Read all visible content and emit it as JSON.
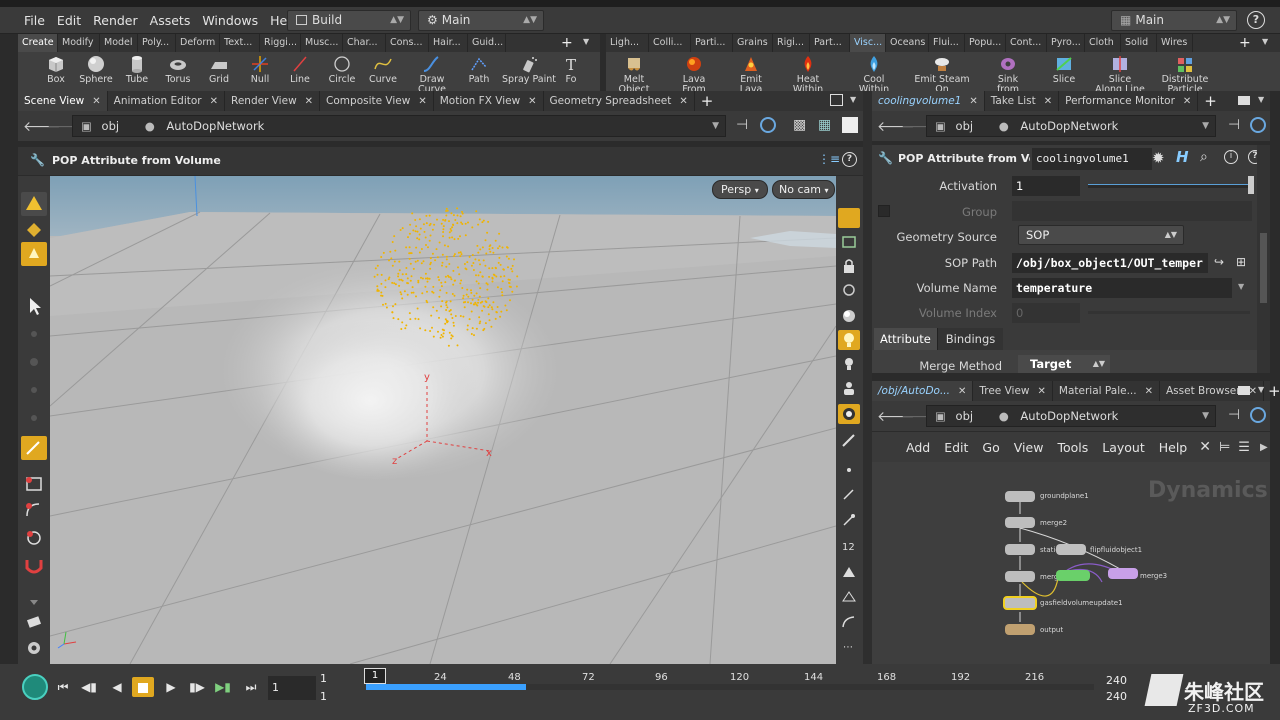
{
  "menubar": {
    "items": [
      "File",
      "Edit",
      "Render",
      "Assets",
      "Windows",
      "Help"
    ],
    "desktop": "Build",
    "context": "Main",
    "right_context": "Main"
  },
  "shelf_left": {
    "tabs": [
      "Create",
      "Modify",
      "Model",
      "Poly...",
      "Deform",
      "Text...",
      "Riggi...",
      "Musc...",
      "Char...",
      "Cons...",
      "Hair...",
      "Guid..."
    ],
    "tools": [
      "Box",
      "Sphere",
      "Tube",
      "Torus",
      "Grid",
      "Null",
      "Line",
      "Circle",
      "Curve",
      "Draw Curve",
      "Path",
      "Spray Paint",
      "Fo"
    ]
  },
  "shelf_right": {
    "tabs": [
      "Ligh...",
      "Colli...",
      "Parti...",
      "Grains",
      "Rigi...",
      "Part...",
      "Visc...",
      "Oceans",
      "Flui...",
      "Popu...",
      "Cont...",
      "Pyro...",
      "Cloth",
      "Solid",
      "Wires"
    ],
    "tools": [
      [
        "Melt Object",
        ""
      ],
      [
        "Lava",
        "From Object"
      ],
      [
        "Emit Lava",
        ""
      ],
      [
        "Heat",
        "Within Object"
      ],
      [
        "Cool",
        "Within Object"
      ],
      [
        "Emit Steam",
        "On Collision"
      ],
      [
        "Sink",
        "from Objects"
      ],
      [
        "Slice",
        ""
      ],
      [
        "Slice",
        "Along Line"
      ],
      [
        "Distribute",
        "Particle Fluid"
      ]
    ]
  },
  "left_panetabs": [
    "Scene View",
    "Animation Editor",
    "Render View",
    "Composite View",
    "Motion FX View",
    "Geometry Spreadsheet"
  ],
  "path": {
    "obj": "obj",
    "network": "AutoDopNetwork"
  },
  "viewport": {
    "title": "POP Attribute from Volume",
    "persp": "Persp",
    "cam": "No cam",
    "axis_y": "y",
    "axis_z": "z",
    "axis_x": "x"
  },
  "right_panetabs": [
    "coolingvolume1",
    "Take List",
    "Performance Monitor"
  ],
  "param": {
    "node_type": "POP Attribute from Vo...",
    "node_name": "coolingvolume1",
    "activation_label": "Activation",
    "activation_value": "1",
    "group_label": "Group",
    "geo_source_label": "Geometry Source",
    "geo_source_value": "SOP",
    "sop_path_label": "SOP Path",
    "sop_path_value": "/obj/box_object1/OUT_temper",
    "volume_name_label": "Volume Name",
    "volume_name_value": "temperature",
    "volume_index_label": "Volume Index",
    "volume_index_value": "0",
    "tab_attribute": "Attribute",
    "tab_bindings": "Bindings",
    "merge_method_label": "Merge Method",
    "merge_method_value": "Target"
  },
  "network_panetabs": [
    "/obj/AutoDo...",
    "Tree View",
    "Material Pale...",
    "Asset Browser"
  ],
  "network_menu": [
    "Add",
    "Edit",
    "Go",
    "View",
    "Tools",
    "Layout",
    "Help"
  ],
  "network": {
    "watermark": "Dynamics",
    "nodes": [
      "groundplane1",
      "merge2",
      "staticsolver1",
      "flipfluidobject1",
      "merge1",
      "merge3",
      "gasfieldvolumeupdate1",
      "output"
    ]
  },
  "timeline": {
    "frame": "1",
    "start": "1",
    "start2": "1",
    "current": "1",
    "ticks": [
      "24",
      "48",
      "72",
      "96",
      "120",
      "144",
      "168",
      "192",
      "216"
    ],
    "end": "240",
    "end2": "240"
  },
  "watermark_text": "朱峰社区",
  "watermark_url": "ZF3D.COM",
  "colors": {
    "accent": "#f0b400",
    "selection": "#3aa0ff",
    "particles": "#f0b400"
  }
}
